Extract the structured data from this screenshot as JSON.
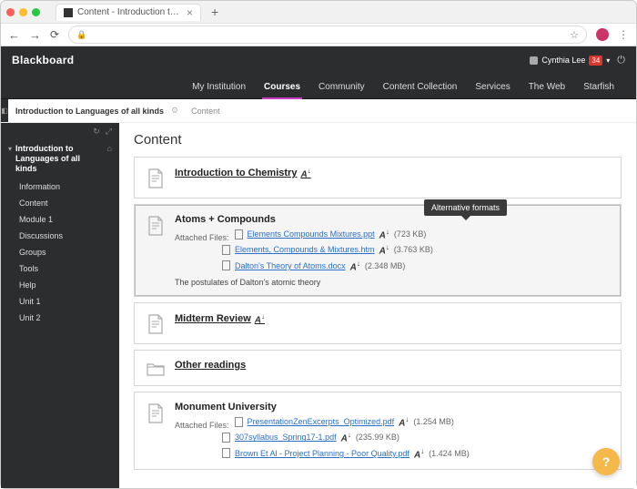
{
  "browser": {
    "tab_title": "Content - Introduction to Lang…",
    "nav_back": "←",
    "nav_fwd": "→",
    "reload": "⟳",
    "star": "☆",
    "kebab": "⋮",
    "add_tab": "+",
    "close_tab": "×",
    "lock": "🔒"
  },
  "appbar": {
    "brand": "Blackboard",
    "user_name": "Cynthia Lee",
    "badge": "34",
    "chev": "▾",
    "power": "⏻"
  },
  "mainnav": {
    "items": [
      {
        "label": "My Institution",
        "active": false
      },
      {
        "label": "Courses",
        "active": true
      },
      {
        "label": "Community",
        "active": false
      },
      {
        "label": "Content Collection",
        "active": false
      },
      {
        "label": "Services",
        "active": false
      },
      {
        "label": "The Web",
        "active": false
      },
      {
        "label": "Starfish",
        "active": false
      }
    ]
  },
  "crumb": {
    "course": "Introduction to Languages of all kinds",
    "gear": "⚙",
    "sub": "Content",
    "pin": "📌"
  },
  "sidebar": {
    "refresh": "↻",
    "expand": "⤢",
    "course_title": "Introduction to Languages of all kinds",
    "arrow": "▾",
    "home": "⌂",
    "items": [
      {
        "label": "Information"
      },
      {
        "label": "Content"
      },
      {
        "label": "Module 1"
      },
      {
        "label": "Discussions"
      },
      {
        "label": "Groups"
      },
      {
        "label": "Tools"
      },
      {
        "label": "Help"
      },
      {
        "label": "Unit 1"
      },
      {
        "label": "Unit 2"
      }
    ]
  },
  "page": {
    "title": "Content",
    "tooltip": "Alternative formats",
    "cards": [
      {
        "type": "doc-link",
        "title": "Introduction to Chemistry",
        "af_icon": true
      },
      {
        "type": "doc-files",
        "highlight": true,
        "title": "Atoms + Compounds",
        "attached_label": "Attached Files:",
        "files": [
          {
            "icon": "doc",
            "name": "Elements Compounds Mixtures.ppt",
            "size": "(723 KB)",
            "af": true
          },
          {
            "icon": "doc",
            "name": "Elements, Compounds & Mixtures.htm",
            "size": "(3.763 KB)",
            "af": true
          },
          {
            "icon": "doc",
            "name": "Dalton's Theory of Atoms.docx",
            "size": "(2.348 MB)",
            "af": true
          }
        ],
        "desc": "The postulates of Dalton's atomic theory"
      },
      {
        "type": "doc-link",
        "title": "Midterm Review",
        "af_icon": true
      },
      {
        "type": "folder-link",
        "title": "Other readings"
      },
      {
        "type": "doc-files",
        "title": "Monument University",
        "attached_label": "Attached Files:",
        "files": [
          {
            "icon": "doc",
            "name": "PresentationZenExcerpts_Optimized.pdf",
            "size": "(1.254 MB)",
            "af": true
          },
          {
            "icon": "doc",
            "name": "307syllabus_Spring17-1.pdf",
            "size": "(235.99 KB)",
            "af": true
          },
          {
            "icon": "doc",
            "name": "Brown Et Al - Project Planning - Poor Quality.pdf",
            "size": "(1.424 MB)",
            "af": true
          }
        ]
      }
    ],
    "fab": "?"
  }
}
